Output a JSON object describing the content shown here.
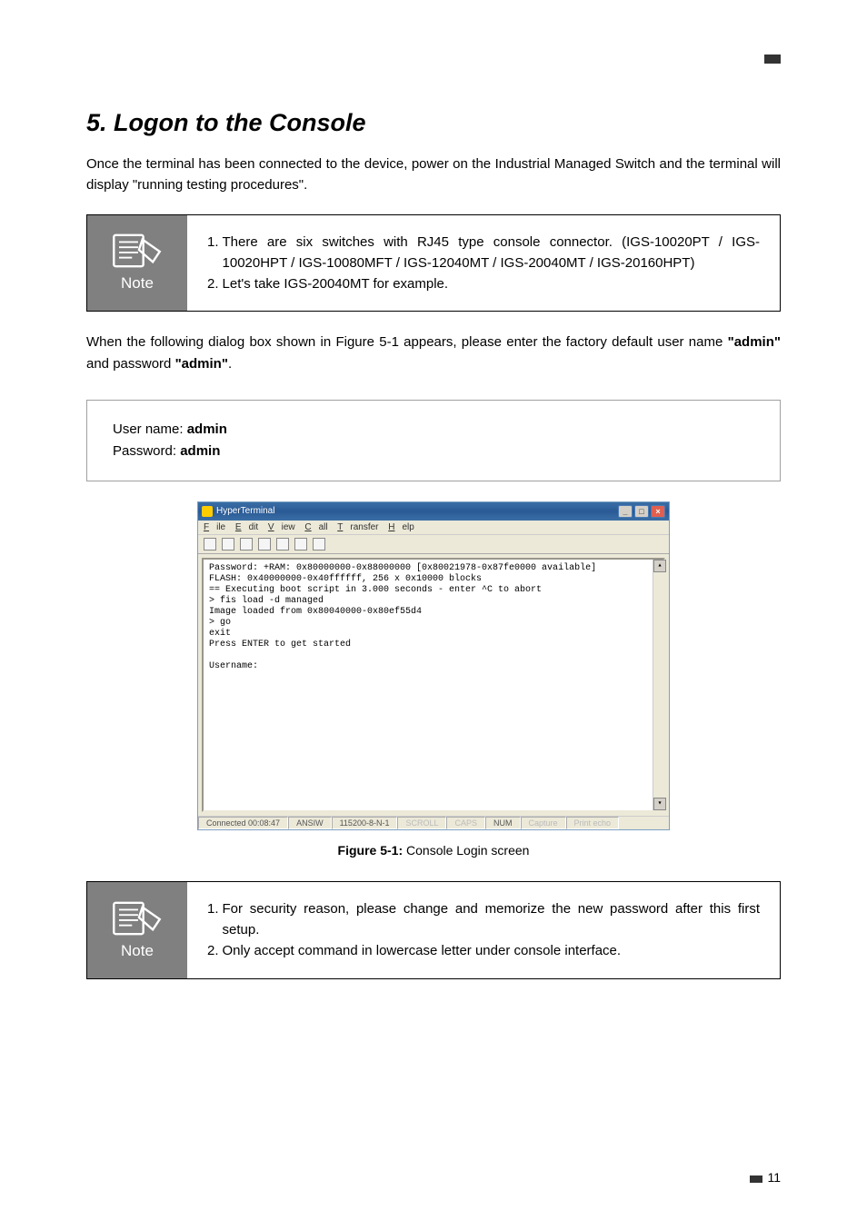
{
  "heading": "5. Logon to the Console",
  "intro_text": "Once the terminal has been connected to the device, power on the Industrial Managed Switch and the terminal will display \"running testing procedures\".",
  "note1": {
    "label": "Note",
    "item1_prefix": "1. ",
    "item1": "There are six switches with RJ45 type console connector. (IGS-10020PT / IGS-10020HPT / IGS-10080MFT / IGS-12040MT / IGS-20040MT / IGS-20160HPT)",
    "item2_prefix": "2. ",
    "item2": "Let's take IGS-20040MT for example."
  },
  "mid_text_pre": "When the following dialog box shown in Figure 5-1 appears, please enter the factory default user name ",
  "mid_text_admin1": "\"admin\"",
  "mid_text_mid": " and password ",
  "mid_text_admin2": "\"admin\"",
  "mid_text_post": ".",
  "creds": {
    "username_label": "User name: ",
    "username_value": "admin",
    "password_label": "Password: ",
    "password_value": "admin"
  },
  "terminal": {
    "title": "HyperTerminal",
    "menu": {
      "file": "File",
      "edit": "Edit",
      "view": "View",
      "call": "Call",
      "transfer": "Transfer",
      "help": "Help"
    },
    "content": "Password: +RAM: 0x80000000-0x88000000 [0x80021978-0x87fe0000 available]\nFLASH: 0x40000000-0x40ffffff, 256 x 0x10000 blocks\n== Executing boot script in 3.000 seconds - enter ^C to abort\n> fis load -d managed\nImage loaded from 0x80040000-0x80ef55d4\n> go\nexit\nPress ENTER to get started\n\nUsername:",
    "status": {
      "connected": "Connected 00:08:47",
      "emulation": "ANSIW",
      "settings": "115200-8-N-1",
      "scroll": "SCROLL",
      "caps": "CAPS",
      "num": "NUM",
      "capture": "Capture",
      "printecho": "Print echo"
    }
  },
  "figure_caption_bold": "Figure 5-1:",
  "figure_caption_rest": "  Console Login screen",
  "note2": {
    "label": "Note",
    "item1_prefix": "1. ",
    "item1": "For security reason, please change and memorize the new password after this first setup.",
    "item2_prefix": "2. ",
    "item2": "Only accept command in lowercase letter under console interface."
  },
  "page_number": "11"
}
